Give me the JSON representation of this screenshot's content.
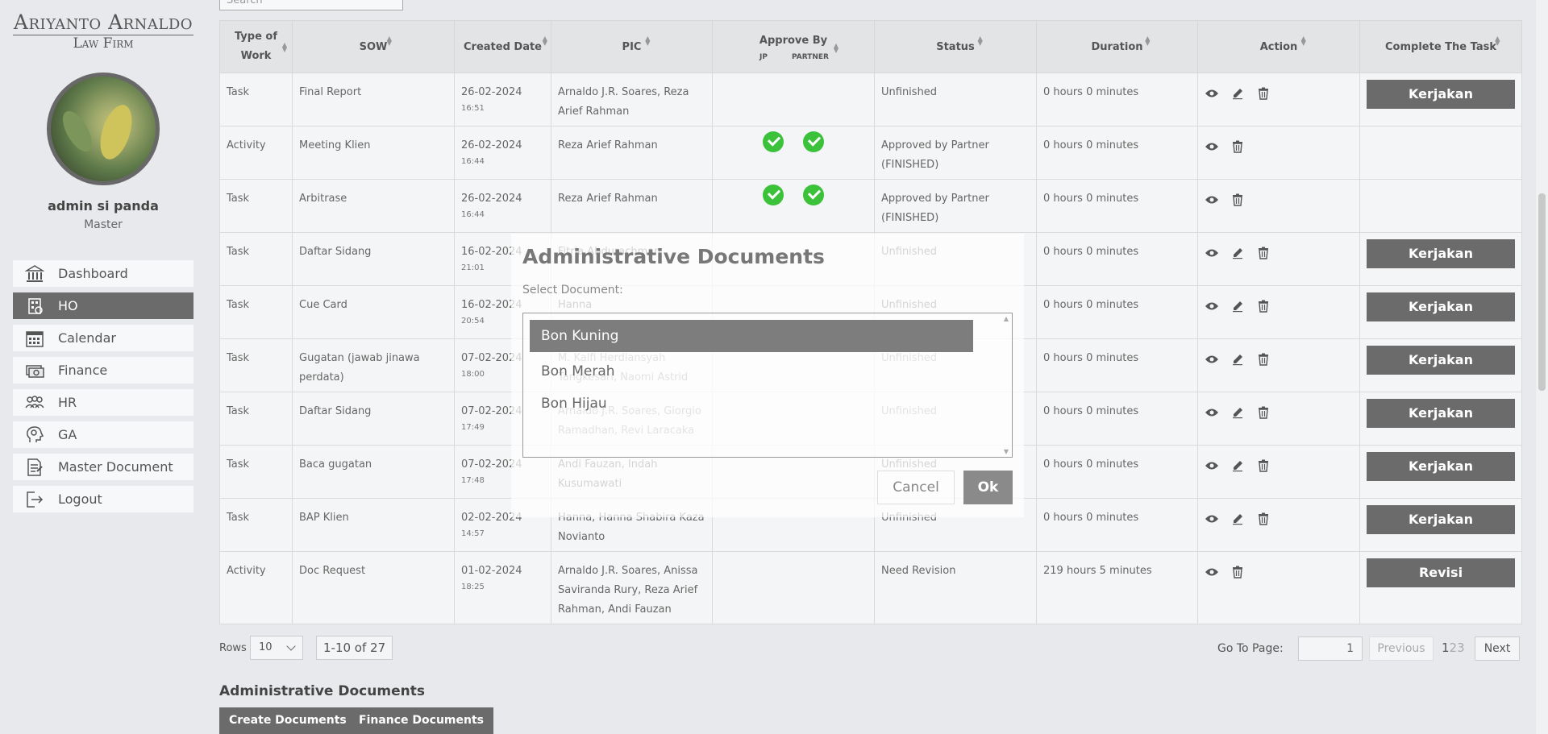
{
  "brand": {
    "line1": "Ariyanto Arnaldo",
    "line2": "Law Firm"
  },
  "user": {
    "name": "admin si panda",
    "role": "Master"
  },
  "nav": [
    {
      "label": "Dashboard",
      "icon": "bank-icon",
      "active": false
    },
    {
      "label": "HO",
      "icon": "building-icon",
      "active": true
    },
    {
      "label": "Calendar",
      "icon": "calendar-icon",
      "active": false
    },
    {
      "label": "Finance",
      "icon": "money-icon",
      "active": false
    },
    {
      "label": "HR",
      "icon": "people-icon",
      "active": false
    },
    {
      "label": "GA",
      "icon": "head-gear-icon",
      "active": false
    },
    {
      "label": "Master Document",
      "icon": "document-icon",
      "active": false
    },
    {
      "label": "Logout",
      "icon": "logout-icon",
      "active": false
    }
  ],
  "search": {
    "placeholder": "Search"
  },
  "table": {
    "headers": [
      "Type of Work",
      "SOW",
      "Created Date",
      "PIC",
      "Approve By",
      "Status",
      "Duration",
      "Action",
      "Complete The Task"
    ],
    "approve_sub": [
      "JP",
      "PARTNER"
    ],
    "rows": [
      {
        "type": "Task",
        "sow": "Final Report",
        "date": "26-02-2024",
        "time": "16:51",
        "pic": "Arnaldo J.R. Soares, Reza Arief Rahman",
        "jp": false,
        "partner": false,
        "status": "Unfinished",
        "duration": "0 hours 0 minutes",
        "edit": true,
        "button": "Kerjakan"
      },
      {
        "type": "Activity",
        "sow": "Meeting Klien",
        "date": "26-02-2024",
        "time": "16:44",
        "pic": "Reza Arief Rahman",
        "jp": true,
        "partner": true,
        "status": "Approved by Partner (FINISHED)",
        "duration": "0 hours 0 minutes",
        "edit": false,
        "button": ""
      },
      {
        "type": "Task",
        "sow": "Arbitrase",
        "date": "26-02-2024",
        "time": "16:44",
        "pic": "Reza Arief Rahman",
        "jp": true,
        "partner": true,
        "status": "Approved by Partner (FINISHED)",
        "duration": "0 hours 0 minutes",
        "edit": false,
        "button": ""
      },
      {
        "type": "Task",
        "sow": "Daftar Sidang",
        "date": "16-02-2024",
        "time": "21:01",
        "pic": "Fitria Abdurachman",
        "jp": false,
        "partner": false,
        "status": "Unfinished",
        "duration": "0 hours 0 minutes",
        "edit": true,
        "button": "Kerjakan"
      },
      {
        "type": "Task",
        "sow": "Cue Card",
        "date": "16-02-2024",
        "time": "20:54",
        "pic": "Hanna",
        "jp": false,
        "partner": false,
        "status": "Unfinished",
        "duration": "0 hours 0 minutes",
        "edit": true,
        "button": "Kerjakan"
      },
      {
        "type": "Task",
        "sow": "Gugatan (jawab jinawa perdata)",
        "date": "07-02-2024",
        "time": "18:00",
        "pic": "M. Kalfi Herdiansyah Tangkesari, Naomi Astrid",
        "jp": false,
        "partner": false,
        "status": "Unfinished",
        "duration": "0 hours 0 minutes",
        "edit": true,
        "button": "Kerjakan"
      },
      {
        "type": "Task",
        "sow": "Daftar Sidang",
        "date": "07-02-2024",
        "time": "17:49",
        "pic": "Arnaldo J.R. Soares, Giorgio Ramadhan, Revi Laracaka",
        "jp": false,
        "partner": false,
        "status": "Unfinished",
        "duration": "0 hours 0 minutes",
        "edit": true,
        "button": "Kerjakan"
      },
      {
        "type": "Task",
        "sow": "Baca gugatan",
        "date": "07-02-2024",
        "time": "17:48",
        "pic": "Andi Fauzan, Indah Kusumawati",
        "jp": false,
        "partner": false,
        "status": "Unfinished",
        "duration": "0 hours 0 minutes",
        "edit": true,
        "button": "Kerjakan"
      },
      {
        "type": "Task",
        "sow": "BAP Klien",
        "date": "02-02-2024",
        "time": "14:57",
        "pic": "Hanna, Hanna Shabira Kaza Novianto",
        "jp": false,
        "partner": false,
        "status": "Unfinished",
        "duration": "0 hours 0 minutes",
        "edit": true,
        "button": "Kerjakan"
      },
      {
        "type": "Activity",
        "sow": "Doc Request",
        "date": "01-02-2024",
        "time": "18:25",
        "pic": "Arnaldo J.R. Soares, Anissa Saviranda Rury, Reza Arief Rahman, Andi Fauzan",
        "jp": false,
        "partner": false,
        "status": "Need Revision",
        "duration": "219 hours 5 minutes",
        "edit": false,
        "button": "Revisi"
      }
    ]
  },
  "pagination": {
    "rows_label": "Rows",
    "rows_value": "10",
    "range": "1-10 of 27",
    "goto_label": "Go To Page:",
    "goto_value": "1",
    "previous": "Previous",
    "pages": [
      "1",
      "2",
      "3"
    ],
    "next": "Next"
  },
  "documents": {
    "title": "Administrative Documents",
    "create_label": "Create Documents",
    "finance_label": "Finance Documents"
  },
  "modal": {
    "title": "Administrative Documents",
    "select_label": "Select Document:",
    "options": [
      "Bon Kuning",
      "Bon Merah",
      "Bon Hijau"
    ],
    "selected_index": 0,
    "cancel": "Cancel",
    "ok": "Ok"
  },
  "colors": {
    "accent": "#6b6b6b",
    "check": "#3cc13b"
  }
}
